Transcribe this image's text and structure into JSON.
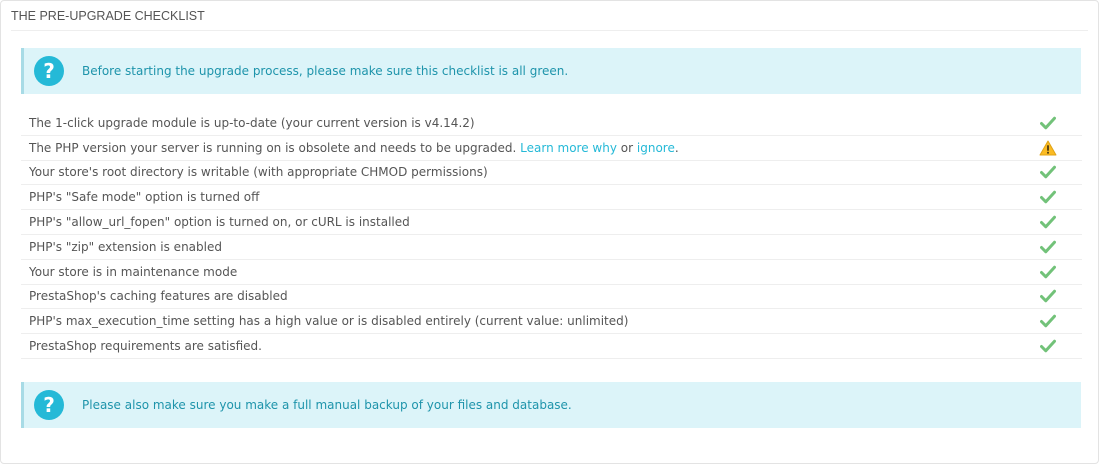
{
  "panel": {
    "title": "THE PRE-UPGRADE CHECKLIST"
  },
  "alerts": {
    "top_icon": "?",
    "top_text": "Before starting the upgrade process, please make sure this checklist is all green.",
    "bottom_icon": "?",
    "bottom_text": "Please also make sure you make a full manual backup of your files and database."
  },
  "checklist": {
    "items": [
      {
        "label": "The 1-click upgrade module is up-to-date (your current version is v4.14.2)",
        "status": "ok"
      },
      {
        "label": "The PHP version your server is running on is obsolete and needs to be upgraded.",
        "link1": "Learn more why",
        "between": "or",
        "link2": "ignore",
        "suffix": ".",
        "status": "warning"
      },
      {
        "label": "Your store's root directory is writable (with appropriate CHMOD permissions)",
        "status": "ok"
      },
      {
        "label": "PHP's \"Safe mode\" option is turned off",
        "status": "ok"
      },
      {
        "label": "PHP's \"allow_url_fopen\" option is turned on, or cURL is installed",
        "status": "ok"
      },
      {
        "label": "PHP's \"zip\" extension is enabled",
        "status": "ok"
      },
      {
        "label": "Your store is in maintenance mode",
        "status": "ok"
      },
      {
        "label": "PrestaShop's caching features are disabled",
        "status": "ok"
      },
      {
        "label": "PHP's max_execution_time setting has a high value or is disabled entirely (current value: unlimited)",
        "status": "ok"
      },
      {
        "label": "PrestaShop requirements are satisfied.",
        "status": "ok"
      }
    ]
  },
  "colors": {
    "ok": "#72c279",
    "warning": "#fbbb22",
    "info": "#25b9d7"
  },
  "icons": {
    "ok": "check-icon",
    "warning": "warning-triangle-icon",
    "info": "question-circle-icon"
  }
}
